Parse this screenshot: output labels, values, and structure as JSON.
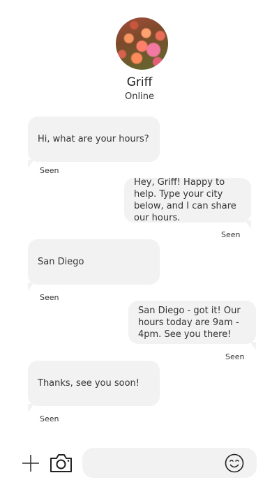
{
  "contact": {
    "name": "Griff",
    "status": "Online"
  },
  "messages": [
    {
      "side": "incoming",
      "text": "Hi, what are your hours?",
      "receipt": "Seen"
    },
    {
      "side": "outgoing",
      "text": "Hey, Griff! Happy to help. Type your city below, and I can share our hours.",
      "receipt": "Seen"
    },
    {
      "side": "incoming",
      "text": "San Diego",
      "receipt": "Seen"
    },
    {
      "side": "outgoing",
      "text": "San Diego - got it! Our hours today are 9am - 4pm. See you there!",
      "receipt": "Seen"
    },
    {
      "side": "incoming",
      "text": "Thanks, see you soon!",
      "receipt": "Seen"
    }
  ],
  "composer": {
    "placeholder": "",
    "icons": [
      "plus-icon",
      "camera-icon",
      "smiley-icon"
    ]
  },
  "colors": {
    "bubble": "#f2f2f2",
    "text": "#333333",
    "background": "#ffffff"
  }
}
